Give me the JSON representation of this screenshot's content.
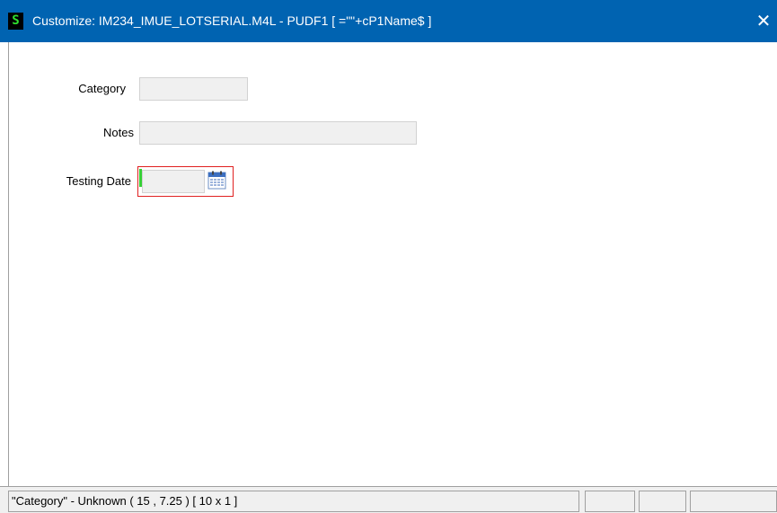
{
  "window": {
    "app_icon": "S",
    "title": "Customize: IM234_IMUE_LOTSERIAL.M4L - PUDF1  [ =\"\"+cP1Name$ ]",
    "close_label": "✕"
  },
  "form": {
    "category": {
      "label": "Category",
      "value": ""
    },
    "notes": {
      "label": "Notes",
      "value": ""
    },
    "testing_date": {
      "label": "Testing Date",
      "value": "",
      "icon": "calendar-icon"
    }
  },
  "statusbar": {
    "message": "\"Category\" - Unknown  ( 15 , 7.25 )  [ 10 x 1 ]",
    "panes": [
      "",
      "",
      ""
    ]
  },
  "colors": {
    "titlebar": "#0063b1",
    "selection_border": "#e02020",
    "focus_marker": "#36d036",
    "field_bg": "#f0f0f0"
  }
}
